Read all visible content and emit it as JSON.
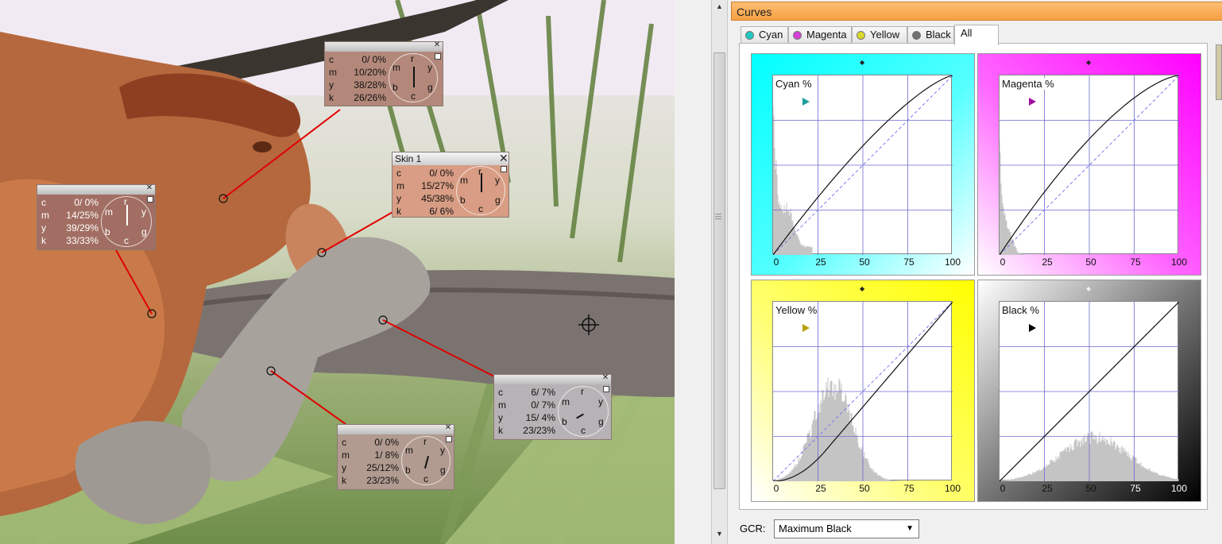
{
  "panel": {
    "title": "Curves"
  },
  "tabs": [
    {
      "label": "Cyan",
      "color": "#22c9c4"
    },
    {
      "label": "Magenta",
      "color": "#d53fd5"
    },
    {
      "label": "Yellow",
      "color": "#d8d82a"
    },
    {
      "label": "Black",
      "color": "#707070"
    },
    {
      "label": "All",
      "active": true
    }
  ],
  "curves": [
    {
      "label": "Cyan %",
      "ticks": [
        "0",
        "25",
        "50",
        "75",
        "100"
      ],
      "accent": "#00ffff"
    },
    {
      "label": "Magenta %",
      "ticks": [
        "0",
        "25",
        "50",
        "75",
        "100"
      ],
      "accent": "#ff00ff"
    },
    {
      "label": "Yellow %",
      "ticks": [
        "0",
        "25",
        "50",
        "75",
        "100"
      ],
      "accent": "#ffff00"
    },
    {
      "label": "Black %",
      "ticks": [
        "0",
        "25",
        "50",
        "75",
        "100"
      ],
      "accent": "#000000"
    }
  ],
  "gcr": {
    "label": "GCR:",
    "value": "Maximum Black"
  },
  "probes": [
    {
      "name": "",
      "c": "0/ 0%",
      "m": "10/20%",
      "y": "38/28%",
      "k": "26/26%",
      "color": "#b3887a"
    },
    {
      "name": "Skin 1",
      "c": "0/ 0%",
      "m": "15/27%",
      "y": "45/38%",
      "k": "6/ 6%",
      "color": "#d89d84"
    },
    {
      "name": "",
      "c": "0/ 0%",
      "m": "14/25%",
      "y": "39/29%",
      "k": "33/33%",
      "color": "#a26e63"
    },
    {
      "name": "",
      "c": "6/ 7%",
      "m": "0/ 7%",
      "y": "15/ 4%",
      "k": "23/23%",
      "color": "#b7b2b5"
    },
    {
      "name": "",
      "c": "0/ 0%",
      "m": "1/ 8%",
      "y": "25/12%",
      "k": "23/23%",
      "color": "#b19a8f"
    }
  ],
  "dial_letters": {
    "r": "r",
    "y": "y",
    "g": "g",
    "c": "c",
    "b": "b",
    "m": "m"
  },
  "channel_letters": {
    "c": "c",
    "m": "m",
    "y": "y",
    "k": "k"
  }
}
